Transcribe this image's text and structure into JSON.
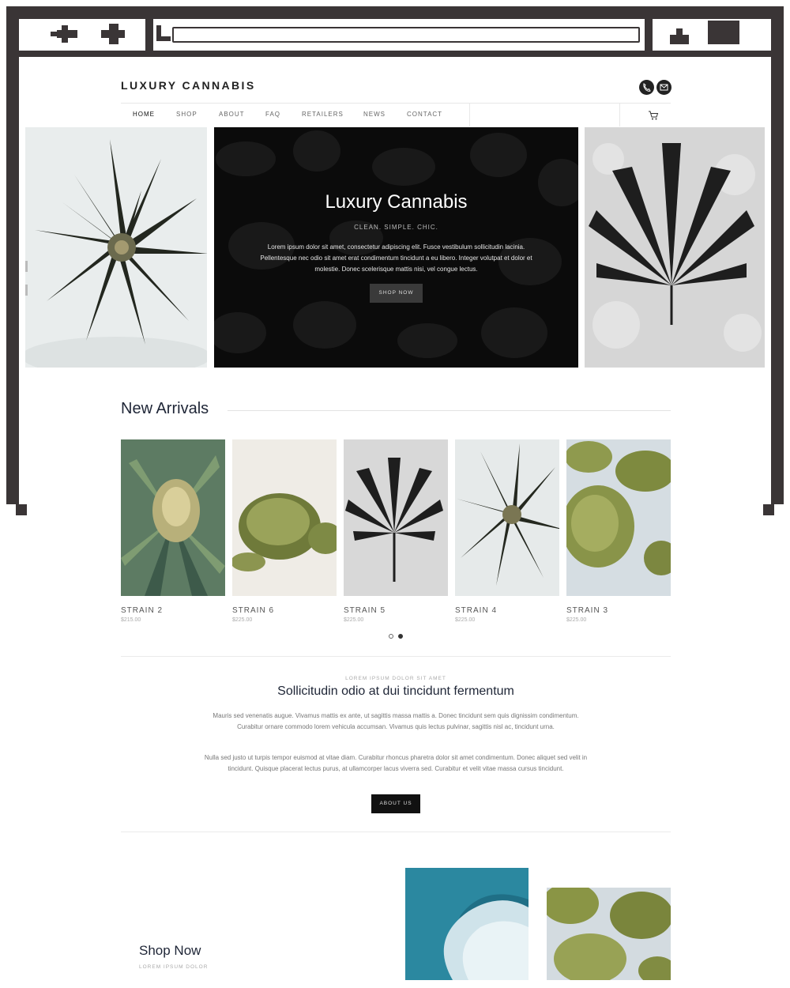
{
  "site": {
    "logo": "LUXURY CANNABIS",
    "header_icons": [
      "phone-icon",
      "mail-icon"
    ],
    "nav": [
      "HOME",
      "SHOP",
      "ABOUT",
      "FAQ",
      "RETAILERS",
      "NEWS",
      "CONTACT"
    ],
    "nav_active": "HOME",
    "cart_icon": "cart-icon"
  },
  "hero": {
    "title": "Luxury Cannabis",
    "subtitle": "CLEAN. SIMPLE. CHIC.",
    "text": "Lorem ipsum dolor sit amet, consectetur adipiscing elit. Fusce vestibulum sollicitudin lacinia. Pellentesque nec odio sit amet erat condimentum tincidunt a eu libero. Integer volutpat et dolor et molestie. Donec scelerisque mattis nisi, vel congue lectus.",
    "button": "SHOP NOW"
  },
  "new_arrivals": {
    "title": "New Arrivals",
    "products": [
      {
        "name": "STRAIN 2",
        "price": "$215.00"
      },
      {
        "name": "STRAIN 6",
        "price": "$225.00"
      },
      {
        "name": "STRAIN 5",
        "price": "$225.00"
      },
      {
        "name": "STRAIN 4",
        "price": "$225.00"
      },
      {
        "name": "STRAIN 3",
        "price": "$225.00"
      }
    ],
    "pager": {
      "pages": 2,
      "active": 2
    }
  },
  "about": {
    "eyebrow": "LOREM IPSUM DOLOR SIT AMET",
    "title": "Sollicitudin odio at dui tincidunt fermentum",
    "para1": "Mauris sed venenatis augue. Vivamus mattis ex ante, ut sagittis massa mattis a. Donec tincidunt sem quis dignissim condimentum. Curabitur ornare commodo lorem vehicula accumsan. Vivamus quis lectus pulvinar, sagittis nisl ac, tincidunt urna.",
    "para2": "Nulla sed justo ut turpis tempor euismod at vitae diam. Curabitur rhoncus pharetra dolor sit amet condimentum. Donec aliquet sed velit in tincidunt. Quisque placerat lectus purus, at ullamcorper lacus viverra sed. Curabitur et velit vitae massa cursus tincidunt.",
    "button": "ABOUT US"
  },
  "shop": {
    "title": "Shop Now",
    "subtitle": "LOREM IPSUM DOLOR"
  },
  "colors": {
    "frame": "#3a3536",
    "accent_dark": "#111111",
    "heading": "#1e2536"
  }
}
